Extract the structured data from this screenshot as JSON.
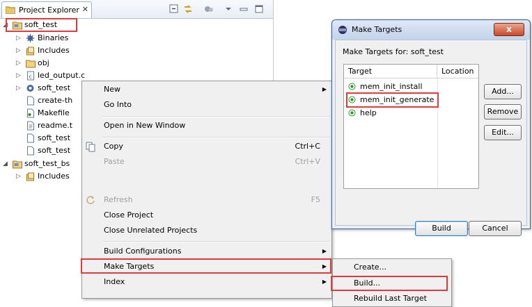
{
  "explorer": {
    "tab_label": "Project Explorer",
    "tab_close": "✕",
    "tree": [
      {
        "label": "soft_test",
        "level": 0,
        "twisty": "◢",
        "icon": "project-folder-icon"
      },
      {
        "label": "Binaries",
        "level": 1,
        "twisty": "▷",
        "icon": "binaries-icon"
      },
      {
        "label": "Includes",
        "level": 1,
        "twisty": "▷",
        "icon": "includes-icon"
      },
      {
        "label": "obj",
        "level": 1,
        "twisty": "▷",
        "icon": "folder-icon"
      },
      {
        "label": "led_output.c",
        "level": 1,
        "twisty": "▷",
        "icon": "c-source-file-icon"
      },
      {
        "label": "soft_test",
        "level": 1,
        "twisty": "▷",
        "icon": "executable-icon"
      },
      {
        "label": "create-th",
        "level": 1,
        "twisty": "",
        "icon": "file-icon"
      },
      {
        "label": "Makefile",
        "level": 1,
        "twisty": "",
        "icon": "makefile-icon"
      },
      {
        "label": "readme.t",
        "level": 1,
        "twisty": "",
        "icon": "text-file-icon"
      },
      {
        "label": "soft_test",
        "level": 1,
        "twisty": "",
        "icon": "file-icon"
      },
      {
        "label": "soft_test",
        "level": 1,
        "twisty": "",
        "icon": "file-icon"
      },
      {
        "label": "soft_test_bs",
        "level": 0,
        "twisty": "◢",
        "icon": "project-folder-icon"
      },
      {
        "label": "Includes",
        "level": 1,
        "twisty": "▷",
        "icon": "includes-icon"
      }
    ]
  },
  "context_menu": {
    "new": "New",
    "go_into": "Go Into",
    "open_new_window": "Open in New Window",
    "copy": "Copy",
    "copy_shortcut": "Ctrl+C",
    "paste": "Paste",
    "paste_shortcut": "Ctrl+V",
    "refresh": "Refresh",
    "refresh_shortcut": "F5",
    "close_project": "Close Project",
    "close_unrelated": "Close Unrelated Projects",
    "build_configurations": "Build Configurations",
    "make_targets": "Make Targets",
    "index": "Index",
    "submenu_arrow": "▶"
  },
  "submenu": {
    "create": "Create...",
    "build": "Build...",
    "rebuild_last": "Rebuild Last Target"
  },
  "dialog": {
    "title": "Make Targets",
    "close_glyph": "x",
    "for_label": "Make Targets for: soft_test",
    "col_target": "Target",
    "col_location": "Location",
    "targets": [
      "mem_init_install",
      "mem_init_generate",
      "help"
    ],
    "selected_target": "mem_init_generate",
    "btn_add": "Add...",
    "btn_remove": "Remove",
    "btn_edit": "Edit...",
    "btn_build": "Build",
    "btn_cancel": "Cancel"
  },
  "colors": {
    "highlight": "#e03a3a",
    "menu_bg": "#f0f0f0",
    "radio_green": "#2f9a2f"
  }
}
